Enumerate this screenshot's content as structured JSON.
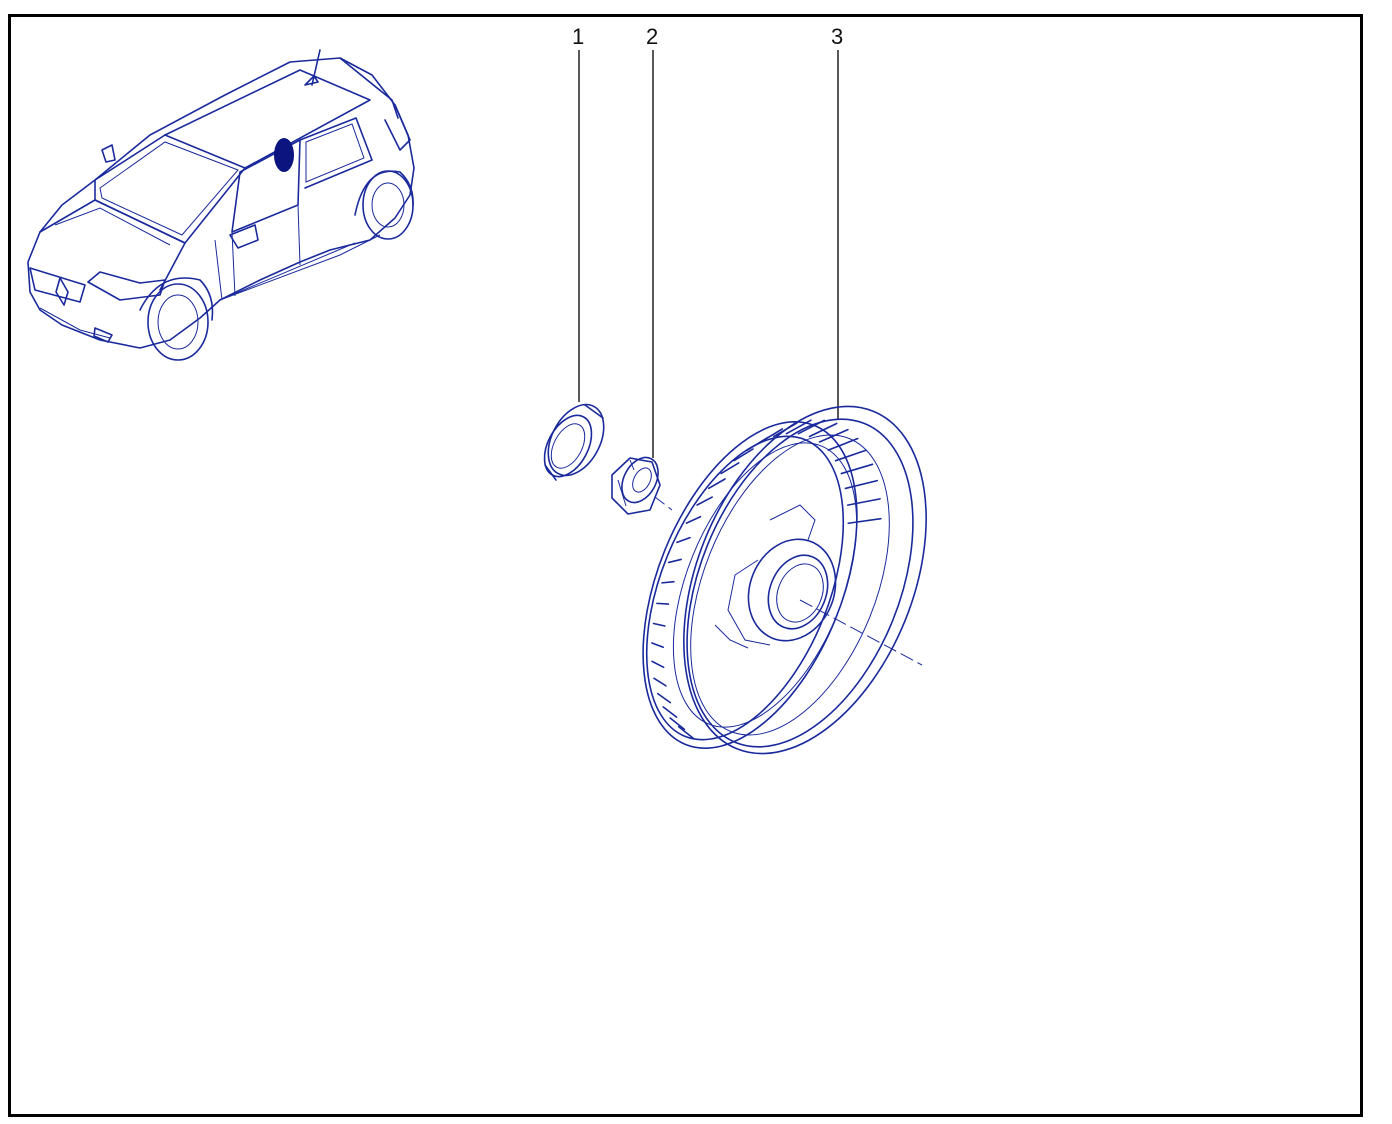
{
  "diagram": {
    "line_color": "#1a2a9c",
    "callouts": [
      {
        "id": "1",
        "label": "1",
        "part": "cap"
      },
      {
        "id": "2",
        "label": "2",
        "part": "hub-nut"
      },
      {
        "id": "3",
        "label": "3",
        "part": "brake-drum"
      }
    ]
  }
}
